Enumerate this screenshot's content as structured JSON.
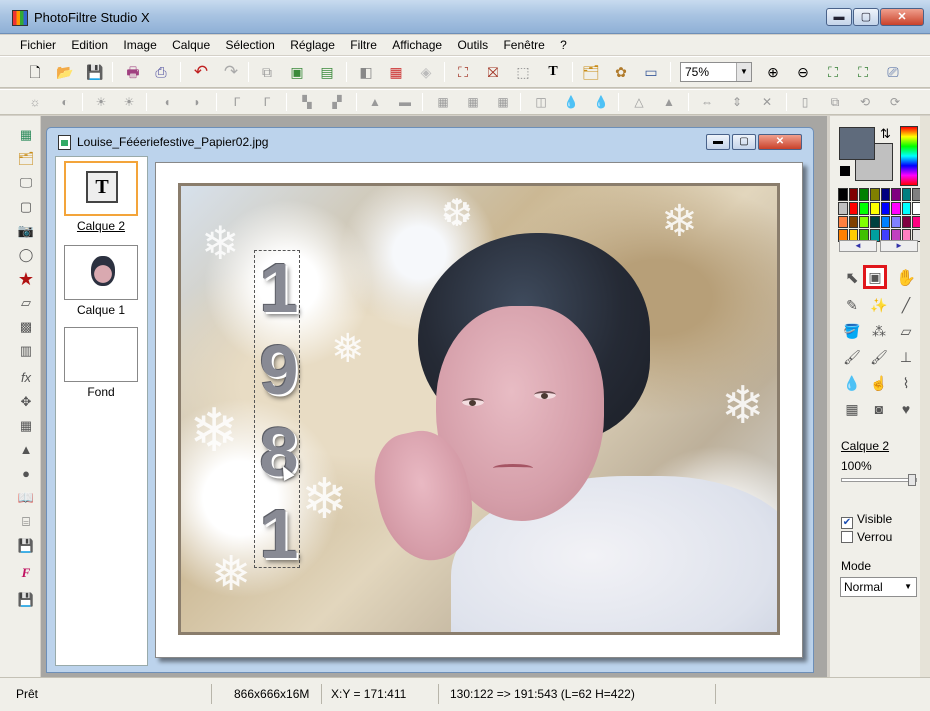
{
  "app": {
    "title": "PhotoFiltre Studio X"
  },
  "window_buttons": {
    "minimize": "▬",
    "maximize": "▢",
    "close": "✕"
  },
  "menu": [
    "Fichier",
    "Edition",
    "Image",
    "Calque",
    "Sélection",
    "Réglage",
    "Filtre",
    "Affichage",
    "Outils",
    "Fenêtre",
    "?"
  ],
  "toolbar": {
    "zoom": "75%"
  },
  "document": {
    "title": "Louise_Fééeriefestive_Papier02.jpg",
    "layers": [
      {
        "name": "Calque 2",
        "selected": true
      },
      {
        "name": "Calque 1",
        "selected": false
      },
      {
        "name": "Fond",
        "selected": false
      }
    ],
    "text_digits": [
      "1",
      "9",
      "8",
      "1"
    ]
  },
  "right_panel": {
    "fg_color": "#5f6b7c",
    "bg_color": "#c0c0c0",
    "palette": [
      "#000000",
      "#800000",
      "#008000",
      "#808000",
      "#000080",
      "#800080",
      "#008080",
      "#808080",
      "#c0c0c0",
      "#ff0000",
      "#00ff00",
      "#ffff00",
      "#0000ff",
      "#ff00ff",
      "#00ffff",
      "#ffffff",
      "#ff8040",
      "#804000",
      "#80ff00",
      "#004040",
      "#0080ff",
      "#8080ff",
      "#800040",
      "#ff0080",
      "#ff8000",
      "#ffcc00",
      "#40c000",
      "#00a0a0",
      "#4040ff",
      "#c040c0",
      "#ff80c0",
      "#e0e0e0"
    ],
    "layer_name": "Calque 2",
    "opacity": "100%",
    "opacity_fraction": 1.0,
    "visible_label": "Visible",
    "visible_checked": true,
    "lock_label": "Verrou",
    "lock_checked": false,
    "mode_label": "Mode",
    "mode_value": "Normal"
  },
  "status": {
    "ready": "Prêt",
    "size": "866x666x16M",
    "coords": "X:Y = 171:411",
    "selection": "130:122 => 191:543 (L=62  H=422)"
  },
  "accent": {
    "highlight_red": "#e0161b",
    "selected_layer_border": "#f3a43a"
  }
}
